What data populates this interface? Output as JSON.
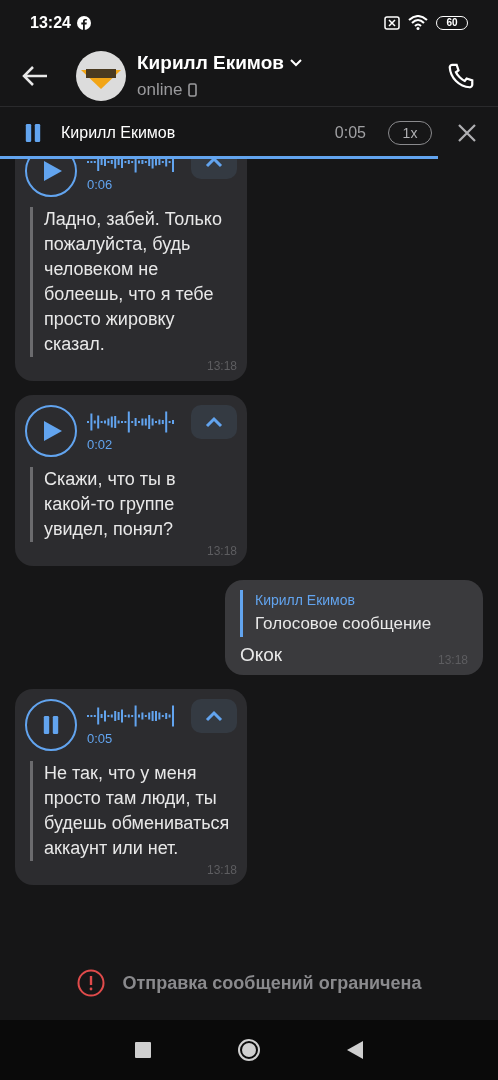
{
  "status_bar": {
    "time": "13:24",
    "battery": "60"
  },
  "header": {
    "name": "Кирилл Екимов",
    "status": "online"
  },
  "player": {
    "playing": true,
    "name": "Кирилл Екимов",
    "time": "0:05",
    "speed": "1x",
    "level": 0.88
  },
  "messages": [
    {
      "kind": "voice",
      "playing": false,
      "duration": "0:06",
      "expanded": true,
      "transcript": "Ладно, забей. Только пожалуйста, будь человеком не болеешь, что я тебе просто жировку сказал.",
      "time": "13:18"
    },
    {
      "kind": "voice",
      "playing": false,
      "duration": "0:02",
      "expanded": true,
      "transcript": "Скажи, что ты в какой-то группе увидел, понял?",
      "time": "13:18"
    },
    {
      "kind": "reply",
      "quote_author": "Кирилл Екимов",
      "quote_text": "Голосовое сообщение",
      "text": "Окок",
      "time": "13:18"
    },
    {
      "kind": "voice",
      "playing": true,
      "duration": "0:05",
      "expanded": true,
      "transcript": "Не так, что у меня просто там люди, ты будешь обмениваться аккаунт или нет.",
      "time": "13:18"
    }
  ],
  "notice": "Отправка сообщений ограничена"
}
